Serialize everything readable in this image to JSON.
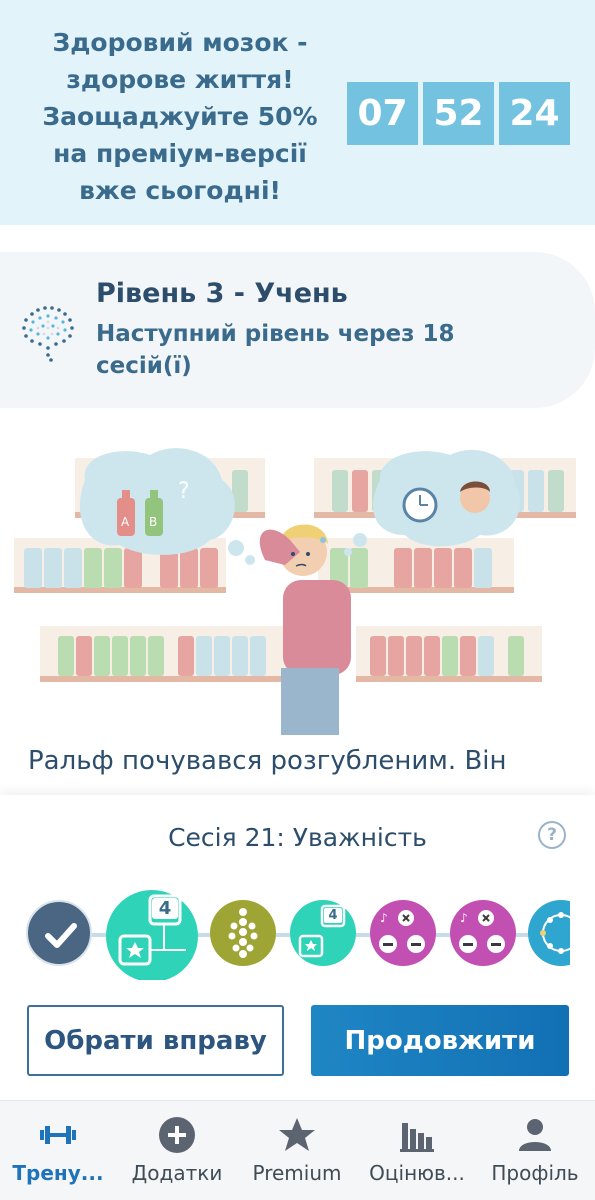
{
  "promo": {
    "text": "Здоровий мозок -\nздорове життя!\nЗаощаджуйте 50%\nна преміум-версії\nвже сьогодні!",
    "timer": [
      "07",
      "52",
      "24"
    ]
  },
  "level": {
    "title": "Рівень 3 - Учень",
    "subtitle": "Наступний рівень через 18 сесій(ї)"
  },
  "story": {
    "text": "Ральф почувався розгубленим. Він"
  },
  "session": {
    "title": "Сесія 21: Уважність",
    "help_icon": "?",
    "games": [
      {
        "icon": "check-icon",
        "color": "#4a6682",
        "state": "completed"
      },
      {
        "icon": "card-star-icon",
        "color": "#2fd3b8",
        "badge": "4"
      },
      {
        "icon": "tree-dots-icon",
        "color": "#9ea534"
      },
      {
        "icon": "card-star-icon",
        "color": "#2fd3b8",
        "badge": "4"
      },
      {
        "icon": "phone-notes-icon",
        "color": "#c24fb2"
      },
      {
        "icon": "phone-notes-icon",
        "color": "#c24fb2"
      },
      {
        "icon": "network-icon",
        "color": "#2fa6cf"
      }
    ]
  },
  "buttons": {
    "choose": "Обрати вправу",
    "continue": "Продовжити"
  },
  "nav": {
    "items": [
      {
        "label": "Трену...",
        "icon": "dumbbell-icon",
        "active": true
      },
      {
        "label": "Додатки",
        "icon": "plus-circle-icon"
      },
      {
        "label": "Premium",
        "icon": "star-icon"
      },
      {
        "label": "Оцінюв...",
        "icon": "bar-chart-icon"
      },
      {
        "label": "Профіль",
        "icon": "person-icon"
      }
    ]
  },
  "colors": {
    "accent": "#1f74b9",
    "banner_bg": "#e3f3fa",
    "timer_bg": "#72c2e0"
  }
}
